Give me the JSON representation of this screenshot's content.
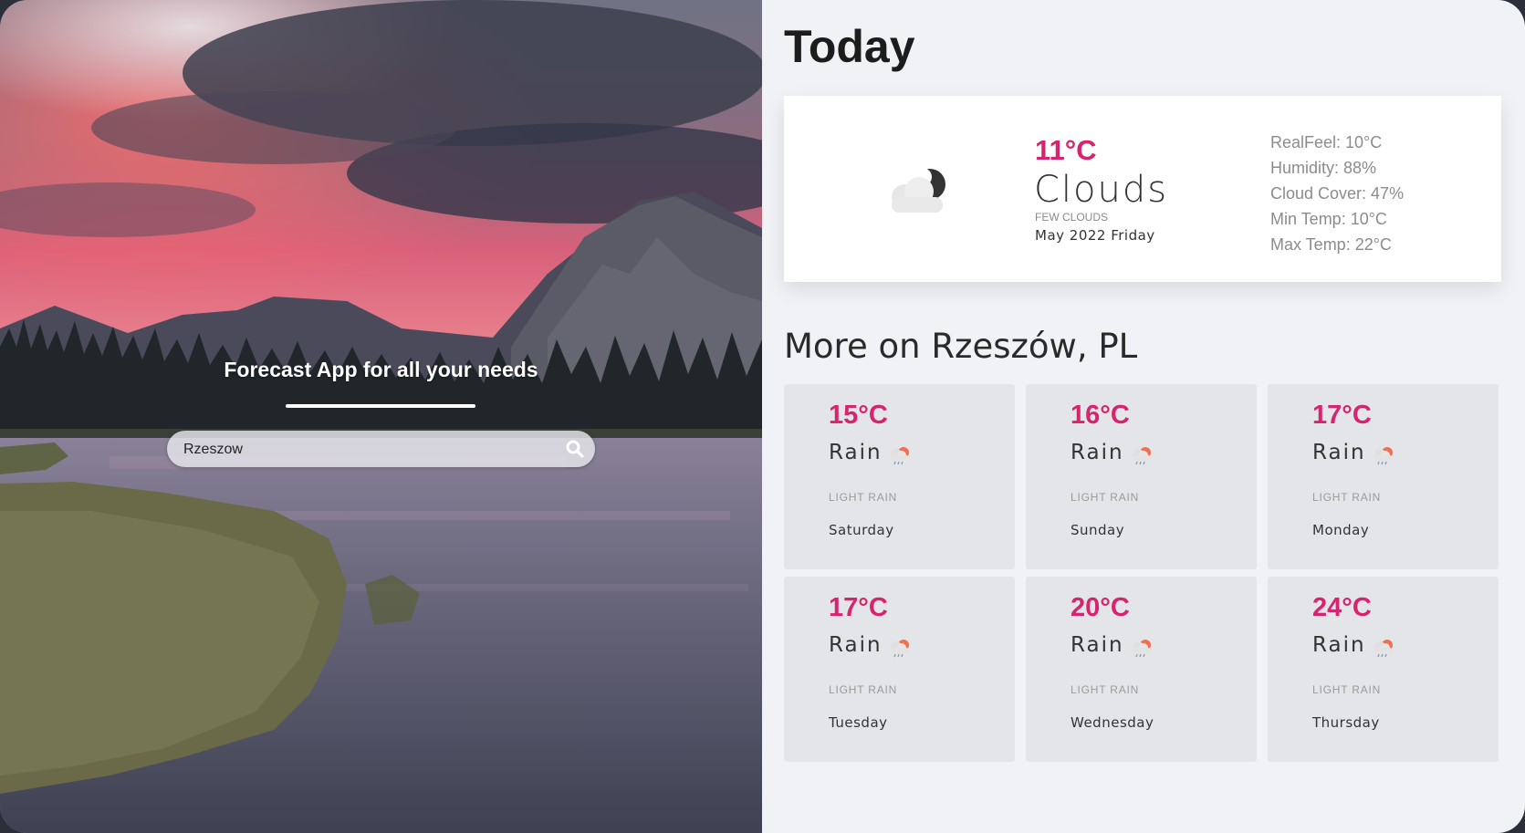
{
  "hero": {
    "title": "Forecast App for all your needs",
    "search": {
      "value": "Rzeszow",
      "placeholder": ""
    }
  },
  "today": {
    "title": "Today",
    "temp": "11°C",
    "condition": "Clouds",
    "description": "FEW CLOUDS",
    "date": "May 2022 Friday",
    "icon": "cloud-moon-icon",
    "details": [
      "RealFeel: 10°C",
      "Humidity: 88%",
      "Cloud Cover: 47%",
      "Min Temp: 10°C",
      "Max Temp: 22°C"
    ]
  },
  "more": {
    "title": "More on Rzeszów, PL",
    "days": [
      {
        "temp": "15°C",
        "condition": "Rain",
        "description": "LIGHT RAIN",
        "day": "Saturday",
        "icon": "rain-icon"
      },
      {
        "temp": "16°C",
        "condition": "Rain",
        "description": "LIGHT RAIN",
        "day": "Sunday",
        "icon": "rain-icon"
      },
      {
        "temp": "17°C",
        "condition": "Rain",
        "description": "LIGHT RAIN",
        "day": "Monday",
        "icon": "rain-icon"
      },
      {
        "temp": "17°C",
        "condition": "Rain",
        "description": "LIGHT RAIN",
        "day": "Tuesday",
        "icon": "rain-icon"
      },
      {
        "temp": "20°C",
        "condition": "Rain",
        "description": "LIGHT RAIN",
        "day": "Wednesday",
        "icon": "rain-icon"
      },
      {
        "temp": "24°C",
        "condition": "Rain",
        "description": "LIGHT RAIN",
        "day": "Thursday",
        "icon": "rain-icon"
      }
    ]
  },
  "colors": {
    "accent": "#d6246e",
    "panel_bg": "#f0f2f5",
    "card_bg": "#e4e5e9"
  }
}
